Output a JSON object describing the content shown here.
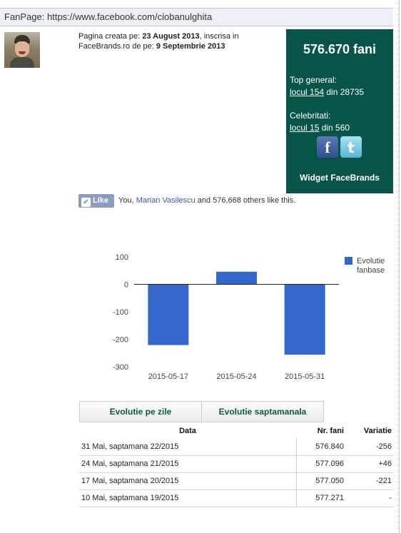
{
  "fanpage": {
    "label": "FanPage: https://www.facebook.com/ciobanulghita"
  },
  "page_info": {
    "created_prefix": "Pagina creata pe: ",
    "created_date": "23 August 2013",
    "registered_prefix": ", inscrisa in FaceBrands.ro de pe: ",
    "registered_date": "9 Septembrie 2013"
  },
  "fans_box": {
    "count": "576.670 fani",
    "top_general_label": "Top general:",
    "top_general_rank": "locul 154",
    "top_general_total": " din 28735",
    "celebrities_label": "Celebritati:",
    "celebrities_rank": "locul 15",
    "celebrities_total": " din 560",
    "facebook_icon": "f",
    "twitter_icon": "t",
    "widget_label": "Widget FaceBrands",
    "bg_color": "#075548"
  },
  "like_bar": {
    "button_label": "Like",
    "text_prefix": "You, ",
    "friend_name": "Marian Vasilescu",
    "text_suffix": " and 576,668 others like this."
  },
  "chart_data": {
    "type": "bar",
    "categories": [
      "2015-05-17",
      "2015-05-24",
      "2015-05-31"
    ],
    "series": [
      {
        "name": "Evolutie fanbase",
        "values": [
          -221,
          46,
          -256
        ],
        "color": "#3366cc"
      }
    ],
    "yticks": [
      100,
      0,
      -100,
      -200,
      -300
    ],
    "ylim": [
      -300,
      100
    ],
    "legend": "right",
    "grid": false
  },
  "tabs": [
    "Evolutie pe zile",
    "Evolutie saptamanala"
  ],
  "table": {
    "headers": {
      "date": "Data",
      "fans": "Nr. fani",
      "variation": "Variatie"
    },
    "rows": [
      {
        "date": "31 Mai, saptamana 22/2015",
        "fans": "576.840",
        "variation": "-256"
      },
      {
        "date": "24 Mai, saptamana 21/2015",
        "fans": "577.096",
        "variation": "+46"
      },
      {
        "date": "17 Mai, saptamana 20/2015",
        "fans": "577.050",
        "variation": "-221"
      },
      {
        "date": "10 Mai, saptamana 19/2015",
        "fans": "577.271",
        "variation": "-"
      }
    ]
  }
}
